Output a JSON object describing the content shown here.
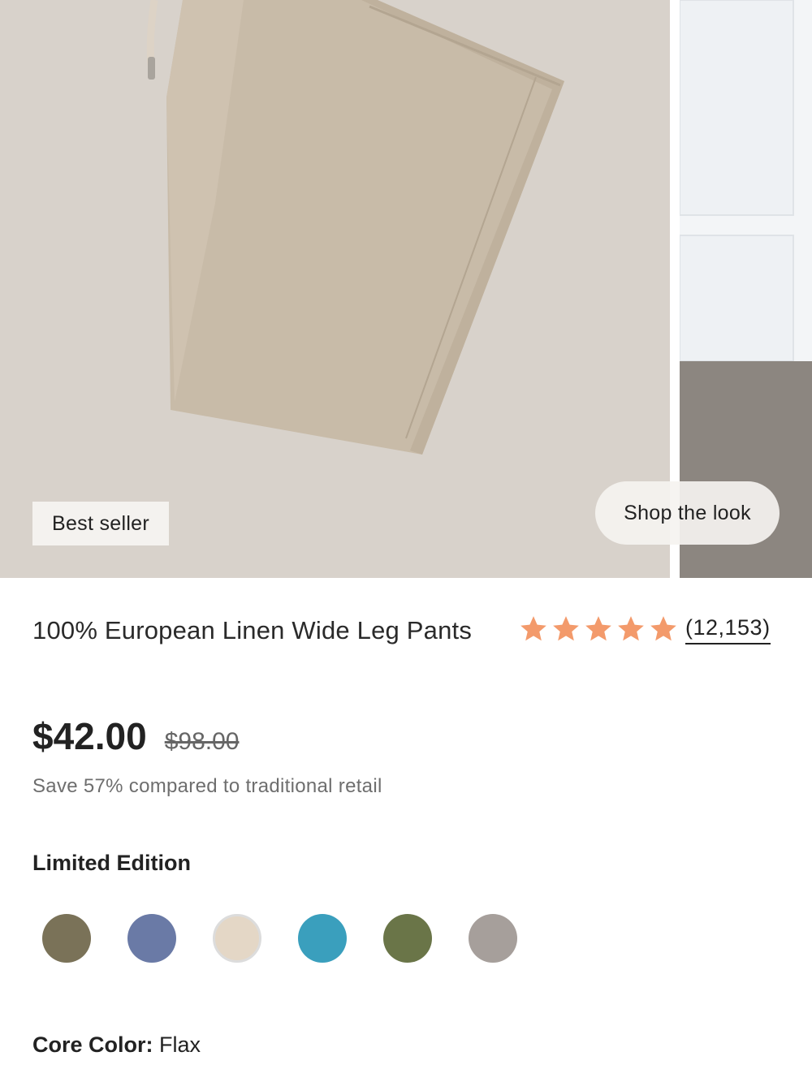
{
  "gallery": {
    "badge": "Best seller",
    "shop_look": "Shop the look"
  },
  "product": {
    "title": "100% European Linen Wide Leg Pants",
    "rating": {
      "stars": 5,
      "count_text": "(12,153)",
      "star_color": "#f39a6b"
    },
    "price": "$42.00",
    "original_price": "$98.00",
    "savings_text": "Save 57% compared to traditional retail",
    "edition_label": "Limited Edition",
    "swatches": [
      {
        "color": "#7a7258"
      },
      {
        "color": "#6a7aa6"
      },
      {
        "color": "#e4d7c6"
      },
      {
        "color": "#3a9fbd"
      },
      {
        "color": "#6a7548"
      },
      {
        "color": "#a69f9b"
      }
    ],
    "core_color_label": "Core Color:",
    "core_color_value": "Flax"
  }
}
